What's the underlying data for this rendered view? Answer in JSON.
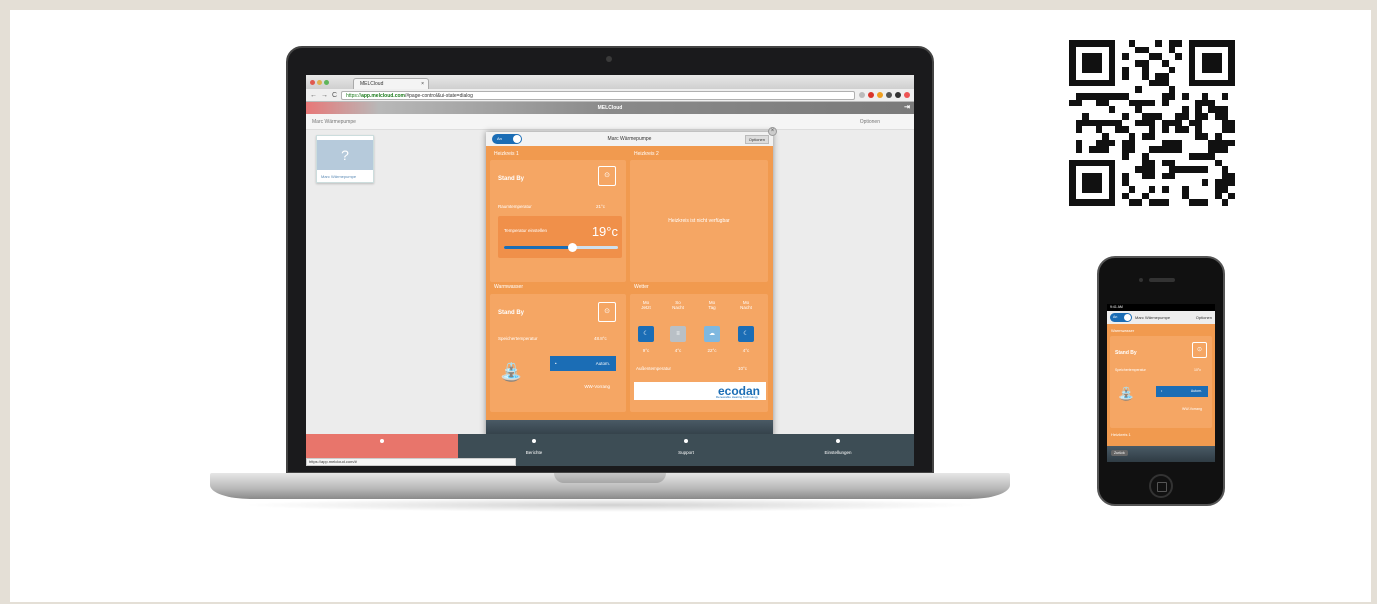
{
  "browser": {
    "tab_title": "MELCloud",
    "tab_close": "×",
    "url_prefix": "https://",
    "url_domain": "app.melcloud.com",
    "url_rest": "/#page-control&ui-state=dialog",
    "status_url": "https://app.melcloud.com/#"
  },
  "app": {
    "title": "MELCloud",
    "device_name": "Marc Wärmepumpe",
    "options_label": "Optionen",
    "device_card_symbol": "?",
    "device_card_caption": "Marc Wärmepumpe"
  },
  "dialog": {
    "toggle_label": "An",
    "title": "Marc Wärmepumpe",
    "options_label": "Optionen",
    "close": "×",
    "heizkreis1": {
      "title": "Heizkreis 1",
      "status": "Stand By",
      "room_temp_label": "Raumtemperatur",
      "room_temp_value": "21°c",
      "set_label": "Temperatur einstellen",
      "set_value": "19°c",
      "slider_fraction": 0.6
    },
    "heizkreis2": {
      "title": "Heizkreis 2",
      "message": "Heizkreis ist nicht verfügbar"
    },
    "warmwasser": {
      "title": "Warmwasser",
      "status": "Stand By",
      "storage_label": "Speichertemperatur",
      "storage_value": "48.8°c",
      "auto_label": "Autom.",
      "boost_label": "WW-Vorrang"
    },
    "wetter": {
      "title": "Wetter",
      "columns": [
        {
          "day": "Mo",
          "time": "Jetzt",
          "temp": "9°c",
          "icon": "moon-icon",
          "color": "#1b6db5"
        },
        {
          "day": "So",
          "time": "Nacht",
          "temp": "4°c",
          "icon": "mist-icon",
          "color": "#b9c0c6"
        },
        {
          "day": "Mo",
          "time": "Tag",
          "temp": "22°c",
          "icon": "cloud-rain-icon",
          "color": "#7fb8e0"
        },
        {
          "day": "Mo",
          "time": "Nacht",
          "temp": "4°c",
          "icon": "moon-icon",
          "color": "#1b6db5"
        }
      ],
      "outside_label": "Außentemperatur",
      "outside_value": "10°c"
    },
    "brand": {
      "name": "ecodan",
      "tagline": "Renewable Heating Technology"
    }
  },
  "bottom_nav": [
    {
      "label": "",
      "active": true
    },
    {
      "label": "Berichte",
      "active": false
    },
    {
      "label": "Support",
      "active": false
    },
    {
      "label": "Einstellungen",
      "active": false
    }
  ],
  "phone": {
    "status": "9:41 AM",
    "toggle_label": "An",
    "title": "Marc Wärmepumpe",
    "options_label": "Optionen",
    "section": "Warmwasser",
    "status_text": "Stand By",
    "storage_label": "Speichertemperatur",
    "storage_value": "10°c",
    "auto_label": "Autom.",
    "boost_label": "WW-Vorrang",
    "section2": "Heizkreis 1",
    "footer_button": "Zurück"
  },
  "colors": {
    "accent": "#f19a4f",
    "blue": "#1b6db5",
    "nav": "#3d4d55",
    "active_nav": "#e8756b"
  }
}
